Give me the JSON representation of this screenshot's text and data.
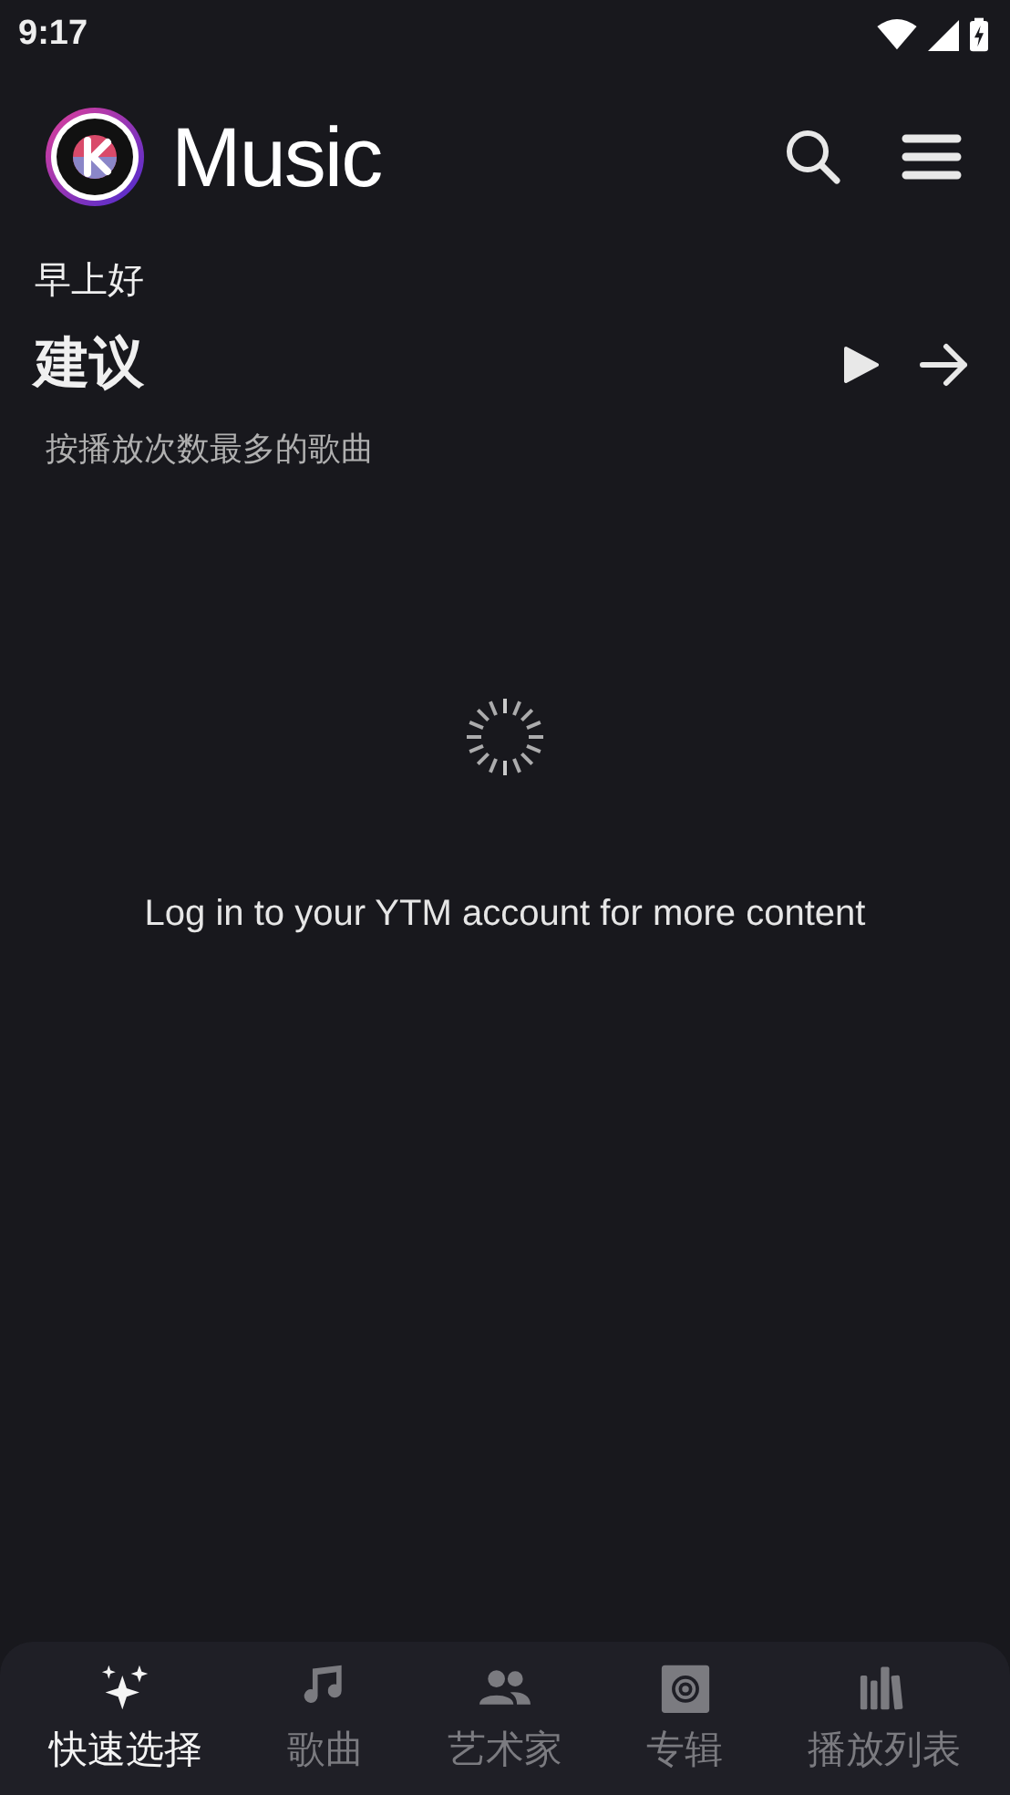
{
  "status_bar": {
    "time": "9:17"
  },
  "app_bar": {
    "title": "Music"
  },
  "greeting": "早上好",
  "section": {
    "title": "建议",
    "subtitle": "按播放次数最多的歌曲"
  },
  "message": "Log in to your YTM account for more content",
  "nav": [
    {
      "label": "快速选择",
      "kind": "sparkles",
      "selected": true
    },
    {
      "label": "歌曲",
      "kind": "note",
      "selected": false
    },
    {
      "label": "艺术家",
      "kind": "people",
      "selected": false
    },
    {
      "label": "专辑",
      "kind": "album",
      "selected": false
    },
    {
      "label": "播放列表",
      "kind": "library",
      "selected": false
    }
  ]
}
